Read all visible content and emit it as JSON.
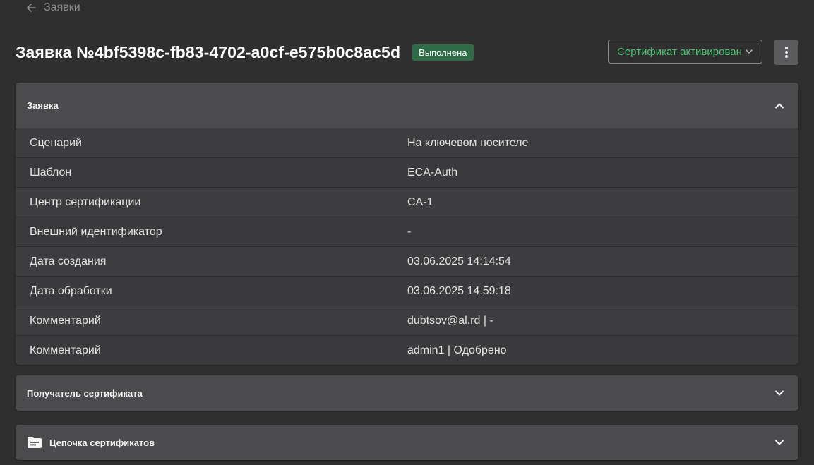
{
  "back": {
    "label": "Заявки",
    "icon": "arrow-left-icon"
  },
  "header": {
    "title": "Заявка №4bf5398c-fb83-4702-a0cf-e575b0c8ac5d",
    "status_badge": "Выполнена",
    "status_select": "Сертификат активирован",
    "more_icon": "more-vertical-icon"
  },
  "request_panel": {
    "title": "Заявка",
    "expanded": true,
    "rows": [
      {
        "label": "Сценарий",
        "value": "На ключевом носителе"
      },
      {
        "label": "Шаблон",
        "value": "ECA-Auth"
      },
      {
        "label": "Центр сертификации",
        "value": "CA-1"
      },
      {
        "label": "Внешний идентификатор",
        "value": "-"
      },
      {
        "label": "Дата создания",
        "value": "03.06.2025 14:14:54"
      },
      {
        "label": "Дата обработки",
        "value": "03.06.2025 14:59:18"
      },
      {
        "label": "Комментарий",
        "value": "dubtsov@al.rd | -"
      },
      {
        "label": "Комментарий",
        "value": "admin1 | Одобрено"
      }
    ]
  },
  "recipient_panel": {
    "title": "Получатель сертификата",
    "expanded": false
  },
  "chain_panel": {
    "title": "Цепочка сертификатов",
    "icon": "folder-icon",
    "expanded": false
  },
  "colors": {
    "background": "#2f2f30",
    "panel_header": "#4b4b4d",
    "badge_green": "#2e6b46",
    "select_text_green": "#4cc474"
  }
}
